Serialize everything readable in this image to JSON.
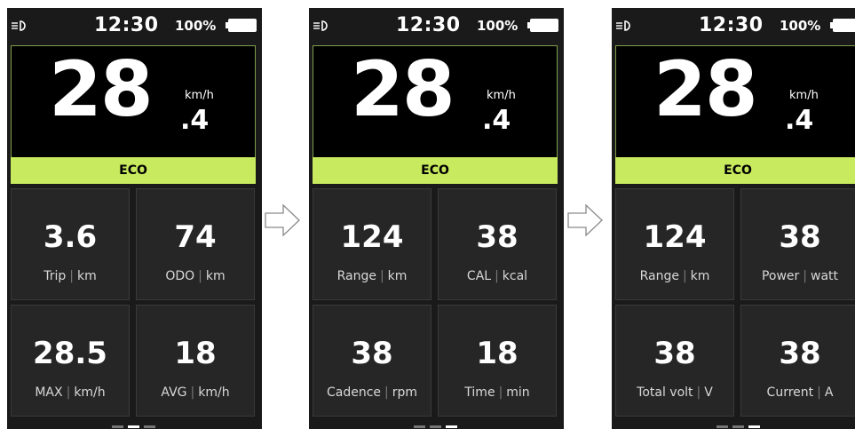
{
  "colors": {
    "mode_bar": "#c8ea5e",
    "screen_bg": "#1a1a1a",
    "tile_bg": "#262626",
    "speed_border": "#7fa04a"
  },
  "icons": {
    "headlight": "headlight-icon",
    "battery": "battery-icon",
    "next": "right-arrow-icon"
  },
  "screens": [
    {
      "status": {
        "time": "12:30",
        "battery_pct": "100%"
      },
      "speed": {
        "integer": "28",
        "decimal": ".4",
        "unit": "km/h"
      },
      "mode": "ECO",
      "tiles": [
        {
          "value": "3.6",
          "label": "Trip",
          "unit": "km"
        },
        {
          "value": "74",
          "label": "ODO",
          "unit": "km"
        },
        {
          "value": "28.5",
          "label": "MAX",
          "unit": "km/h"
        },
        {
          "value": "18",
          "label": "AVG",
          "unit": "km/h"
        }
      ],
      "active_page": 2,
      "page_count": 3
    },
    {
      "status": {
        "time": "12:30",
        "battery_pct": "100%"
      },
      "speed": {
        "integer": "28",
        "decimal": ".4",
        "unit": "km/h"
      },
      "mode": "ECO",
      "tiles": [
        {
          "value": "124",
          "label": "Range",
          "unit": "km"
        },
        {
          "value": "38",
          "label": "CAL",
          "unit": "kcal"
        },
        {
          "value": "38",
          "label": "Cadence",
          "unit": "rpm"
        },
        {
          "value": "18",
          "label": "Time",
          "unit": "min"
        }
      ],
      "active_page": 3,
      "page_count": 3
    },
    {
      "status": {
        "time": "12:30",
        "battery_pct": "100%"
      },
      "speed": {
        "integer": "28",
        "decimal": ".4",
        "unit": "km/h"
      },
      "mode": "ECO",
      "tiles": [
        {
          "value": "124",
          "label": "Range",
          "unit": "km"
        },
        {
          "value": "38",
          "label": "Power",
          "unit": "watt"
        },
        {
          "value": "38",
          "label": "Total volt",
          "unit": "V"
        },
        {
          "value": "38",
          "label": "Current",
          "unit": "A"
        }
      ],
      "active_page": 3,
      "page_count": 3
    }
  ]
}
